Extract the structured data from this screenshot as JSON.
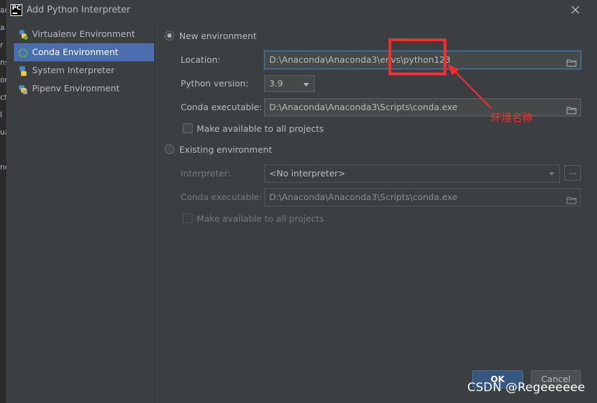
{
  "background_ide": {
    "side_fragments": [
      "ar",
      "a",
      "r",
      "ns",
      "on",
      "ct",
      "I",
      "ua",
      "no"
    ]
  },
  "dialog": {
    "app_icon": "PC",
    "title": "Add Python Interpreter",
    "close_icon": "close-icon"
  },
  "sidebar": {
    "items": [
      {
        "label": "Virtualenv Environment",
        "icon": "virtualenv-icon",
        "selected": false
      },
      {
        "label": "Conda Environment",
        "icon": "conda-icon",
        "selected": true
      },
      {
        "label": "System Interpreter",
        "icon": "python-icon",
        "selected": false
      },
      {
        "label": "Pipenv Environment",
        "icon": "pipenv-icon",
        "selected": false
      }
    ]
  },
  "new_env": {
    "radio_label": "New environment",
    "location_label": "Location:",
    "location_value": "D:\\Anaconda\\Anaconda3\\envs\\python123",
    "python_version_label": "Python version:",
    "python_version_value": "3.9",
    "conda_exec_label": "Conda executable:",
    "conda_exec_value": "D:\\Anaconda\\Anaconda3\\Scripts\\conda.exe",
    "make_available_label": "Make available to all projects"
  },
  "existing_env": {
    "radio_label": "Existing environment",
    "interpreter_label": "Interpreter:",
    "interpreter_value": "<No interpreter>",
    "browse_label": "...",
    "conda_exec_label": "Conda executable:",
    "conda_exec_value": "D:\\Anaconda\\Anaconda3\\Scripts\\conda.exe",
    "make_available_label": "Make available to all projects"
  },
  "annotation": {
    "text": "环境名称",
    "color": "#ff2a2a"
  },
  "footer": {
    "ok_label": "OK",
    "cancel_label": "Cancel",
    "watermark": "CSDN @Regeeeeee"
  },
  "colors": {
    "background": "#3c3f41",
    "selection": "#4b6eaf",
    "primary_button": "#365880"
  }
}
